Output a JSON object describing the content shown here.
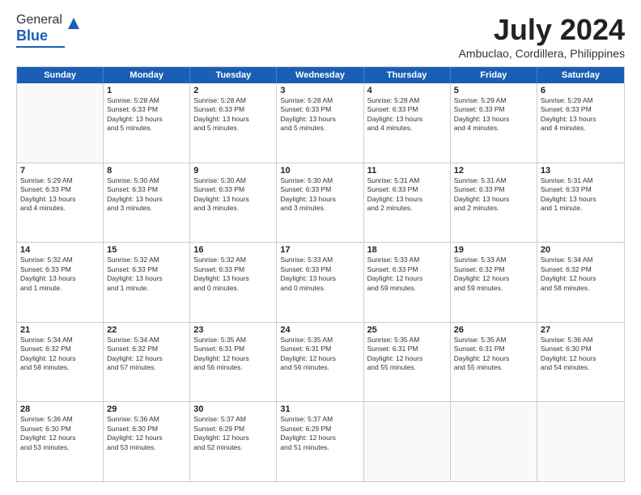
{
  "logo": {
    "line1": "General",
    "line2": "Blue"
  },
  "title": "July 2024",
  "location": "Ambuclao, Cordillera, Philippines",
  "header_days": [
    "Sunday",
    "Monday",
    "Tuesday",
    "Wednesday",
    "Thursday",
    "Friday",
    "Saturday"
  ],
  "weeks": [
    [
      {
        "day": "",
        "info": ""
      },
      {
        "day": "1",
        "info": "Sunrise: 5:28 AM\nSunset: 6:33 PM\nDaylight: 13 hours\nand 5 minutes."
      },
      {
        "day": "2",
        "info": "Sunrise: 5:28 AM\nSunset: 6:33 PM\nDaylight: 13 hours\nand 5 minutes."
      },
      {
        "day": "3",
        "info": "Sunrise: 5:28 AM\nSunset: 6:33 PM\nDaylight: 13 hours\nand 5 minutes."
      },
      {
        "day": "4",
        "info": "Sunrise: 5:28 AM\nSunset: 6:33 PM\nDaylight: 13 hours\nand 4 minutes."
      },
      {
        "day": "5",
        "info": "Sunrise: 5:29 AM\nSunset: 6:33 PM\nDaylight: 13 hours\nand 4 minutes."
      },
      {
        "day": "6",
        "info": "Sunrise: 5:29 AM\nSunset: 6:33 PM\nDaylight: 13 hours\nand 4 minutes."
      }
    ],
    [
      {
        "day": "7",
        "info": "Sunrise: 5:29 AM\nSunset: 6:33 PM\nDaylight: 13 hours\nand 4 minutes."
      },
      {
        "day": "8",
        "info": "Sunrise: 5:30 AM\nSunset: 6:33 PM\nDaylight: 13 hours\nand 3 minutes."
      },
      {
        "day": "9",
        "info": "Sunrise: 5:30 AM\nSunset: 6:33 PM\nDaylight: 13 hours\nand 3 minutes."
      },
      {
        "day": "10",
        "info": "Sunrise: 5:30 AM\nSunset: 6:33 PM\nDaylight: 13 hours\nand 3 minutes."
      },
      {
        "day": "11",
        "info": "Sunrise: 5:31 AM\nSunset: 6:33 PM\nDaylight: 13 hours\nand 2 minutes."
      },
      {
        "day": "12",
        "info": "Sunrise: 5:31 AM\nSunset: 6:33 PM\nDaylight: 13 hours\nand 2 minutes."
      },
      {
        "day": "13",
        "info": "Sunrise: 5:31 AM\nSunset: 6:33 PM\nDaylight: 13 hours\nand 1 minute."
      }
    ],
    [
      {
        "day": "14",
        "info": "Sunrise: 5:32 AM\nSunset: 6:33 PM\nDaylight: 13 hours\nand 1 minute."
      },
      {
        "day": "15",
        "info": "Sunrise: 5:32 AM\nSunset: 6:33 PM\nDaylight: 13 hours\nand 1 minute."
      },
      {
        "day": "16",
        "info": "Sunrise: 5:32 AM\nSunset: 6:33 PM\nDaylight: 13 hours\nand 0 minutes."
      },
      {
        "day": "17",
        "info": "Sunrise: 5:33 AM\nSunset: 6:33 PM\nDaylight: 13 hours\nand 0 minutes."
      },
      {
        "day": "18",
        "info": "Sunrise: 5:33 AM\nSunset: 6:33 PM\nDaylight: 12 hours\nand 59 minutes."
      },
      {
        "day": "19",
        "info": "Sunrise: 5:33 AM\nSunset: 6:32 PM\nDaylight: 12 hours\nand 59 minutes."
      },
      {
        "day": "20",
        "info": "Sunrise: 5:34 AM\nSunset: 6:32 PM\nDaylight: 12 hours\nand 58 minutes."
      }
    ],
    [
      {
        "day": "21",
        "info": "Sunrise: 5:34 AM\nSunset: 6:32 PM\nDaylight: 12 hours\nand 58 minutes."
      },
      {
        "day": "22",
        "info": "Sunrise: 5:34 AM\nSunset: 6:32 PM\nDaylight: 12 hours\nand 57 minutes."
      },
      {
        "day": "23",
        "info": "Sunrise: 5:35 AM\nSunset: 6:31 PM\nDaylight: 12 hours\nand 56 minutes."
      },
      {
        "day": "24",
        "info": "Sunrise: 5:35 AM\nSunset: 6:31 PM\nDaylight: 12 hours\nand 56 minutes."
      },
      {
        "day": "25",
        "info": "Sunrise: 5:35 AM\nSunset: 6:31 PM\nDaylight: 12 hours\nand 55 minutes."
      },
      {
        "day": "26",
        "info": "Sunrise: 5:35 AM\nSunset: 6:31 PM\nDaylight: 12 hours\nand 55 minutes."
      },
      {
        "day": "27",
        "info": "Sunrise: 5:36 AM\nSunset: 6:30 PM\nDaylight: 12 hours\nand 54 minutes."
      }
    ],
    [
      {
        "day": "28",
        "info": "Sunrise: 5:36 AM\nSunset: 6:30 PM\nDaylight: 12 hours\nand 53 minutes."
      },
      {
        "day": "29",
        "info": "Sunrise: 5:36 AM\nSunset: 6:30 PM\nDaylight: 12 hours\nand 53 minutes."
      },
      {
        "day": "30",
        "info": "Sunrise: 5:37 AM\nSunset: 6:29 PM\nDaylight: 12 hours\nand 52 minutes."
      },
      {
        "day": "31",
        "info": "Sunrise: 5:37 AM\nSunset: 6:29 PM\nDaylight: 12 hours\nand 51 minutes."
      },
      {
        "day": "",
        "info": ""
      },
      {
        "day": "",
        "info": ""
      },
      {
        "day": "",
        "info": ""
      }
    ]
  ]
}
